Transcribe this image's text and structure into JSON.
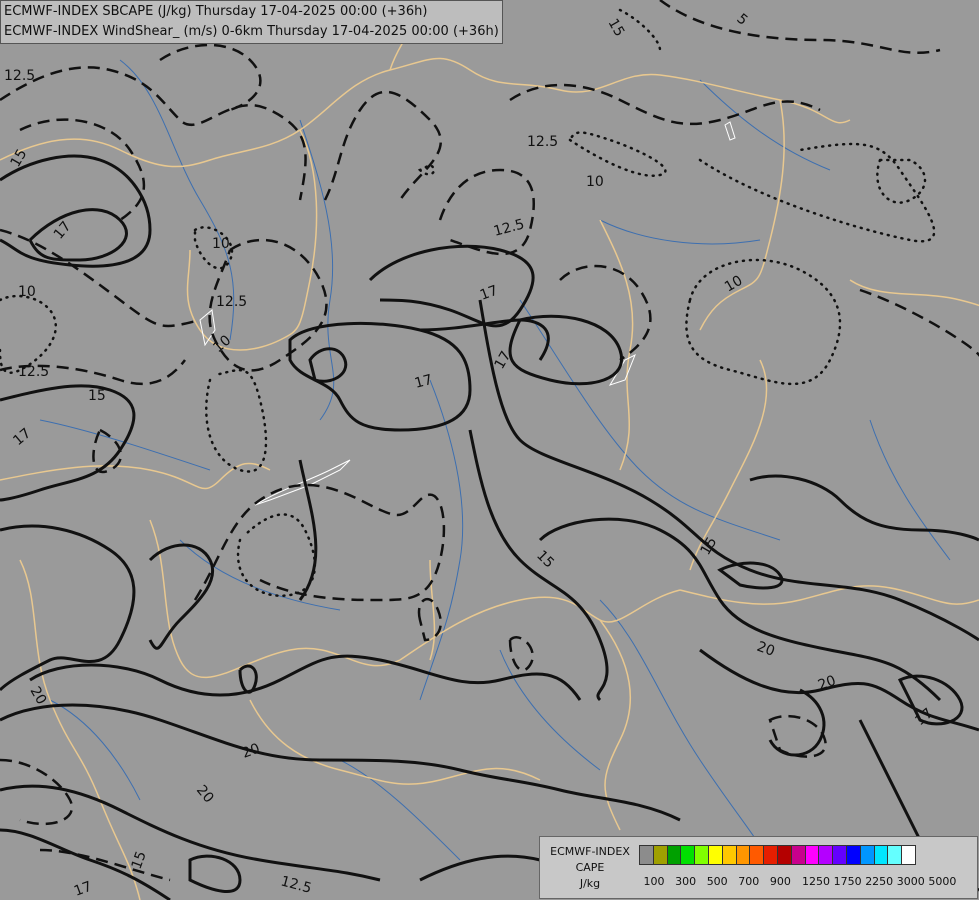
{
  "header": {
    "line1": "ECMWF-INDEX SBCAPE (J/kg) Thursday 17-04-2025 00:00 (+36h)",
    "line2": "ECMWF-INDEX WindShear_ (m/s) 0-6km Thursday 17-04-2025 00:00 (+36h)"
  },
  "contour_labels": [
    "12.5",
    "15",
    "17",
    "10",
    "12.5",
    "10",
    "12.5",
    "15",
    "17",
    "12.5",
    "17",
    "17",
    "10",
    "12.5",
    "17",
    "10",
    "15",
    "15",
    "20",
    "20",
    "20",
    "20",
    "17",
    "15",
    "17",
    "20",
    "12.5",
    "5",
    "15",
    "10"
  ],
  "legend": {
    "title1": "ECMWF-INDEX",
    "title2": "CAPE",
    "unit": "J/kg",
    "colors": [
      "#8c8c8c",
      "#a0a000",
      "#00a000",
      "#00e000",
      "#80ff00",
      "#ffff00",
      "#ffc800",
      "#ff9600",
      "#ff5a00",
      "#e61e00",
      "#b40000",
      "#c8008c",
      "#ff00ff",
      "#b400ff",
      "#6400ff",
      "#0000ff",
      "#0096ff",
      "#00e6ff",
      "#64ffff",
      "#ffffff"
    ],
    "ticks": [
      "100",
      "300",
      "500",
      "700",
      "900",
      "1250",
      "1750",
      "2250",
      "3000",
      "5000"
    ]
  }
}
